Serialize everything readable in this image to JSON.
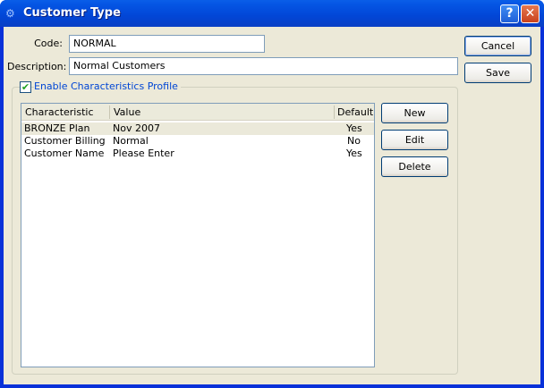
{
  "window": {
    "title": "Customer Type",
    "help_label": "?",
    "close_label": "✕"
  },
  "form": {
    "code_label": "Code:",
    "code_value": "NORMAL",
    "description_label": "Description:",
    "description_value": "Normal Customers"
  },
  "buttons": {
    "cancel": "Cancel",
    "save": "Save",
    "new": "New",
    "edit": "Edit",
    "delete": "Delete"
  },
  "profile": {
    "enable_label": "Enable Characteristics Profile",
    "checked": true
  },
  "table": {
    "columns": [
      "Characteristic",
      "Value",
      "Default"
    ],
    "rows": [
      {
        "characteristic": "BRONZE Plan",
        "value": "Nov 2007",
        "default": "Yes"
      },
      {
        "characteristic": "Customer Billing",
        "value": "Normal",
        "default": "No"
      },
      {
        "characteristic": "Customer Name",
        "value": "Please Enter",
        "default": "Yes"
      }
    ]
  }
}
